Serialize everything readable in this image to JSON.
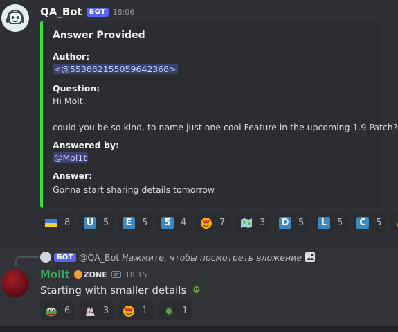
{
  "message1": {
    "username": "QA_Bot",
    "bot_tag": "БОТ",
    "timestamp": "18:06",
    "embed": {
      "accent_color": "#3ae03a",
      "title": "Answer Provided",
      "author_label": "Author:",
      "author_value": "<@553882155059642368>",
      "question_label": "Question:",
      "question_line1": "Hi Molt,",
      "question_line2": "could you be so kind, to name just one cool Feature in the upcoming 1.9 Patch?",
      "answered_by_label": "Answered by:",
      "answered_by_value": "@Mol1t",
      "answer_label": "Answer:",
      "answer_value": "Gonna start sharing details tomorrow"
    },
    "reactions": [
      {
        "icon": "ukraine-flag-icon",
        "count": "8"
      },
      {
        "icon": "regional-u-icon",
        "glyph": "U",
        "count": "5"
      },
      {
        "icon": "regional-e-icon",
        "glyph": "E",
        "count": "5"
      },
      {
        "icon": "digit-5-icon",
        "glyph": "5",
        "count": "4"
      },
      {
        "icon": "smiling-heart-icon",
        "count": "7"
      },
      {
        "icon": "map-icon",
        "count": "3"
      },
      {
        "icon": "regional-d-icon",
        "glyph": "D",
        "count": "5"
      },
      {
        "icon": "regional-l-icon",
        "glyph": "L",
        "count": "5"
      },
      {
        "icon": "regional-c-icon",
        "glyph": "C",
        "count": "5"
      }
    ]
  },
  "message2": {
    "reply": {
      "bot_tag": "БОТ",
      "name": "@QA_Bot",
      "text": "Нажмите, чтобы посмотреть вложение"
    },
    "username": "Mollt",
    "name_color": "#3ba55d",
    "zone_tag": "ZONE",
    "timestamp": "18:15",
    "text": "Starting with smaller details",
    "reactions": [
      {
        "icon": "pepe-icon",
        "count": "6"
      },
      {
        "icon": "creature-icon",
        "count": "3"
      },
      {
        "icon": "smiling-heart-icon",
        "count": "1"
      },
      {
        "icon": "hooded-figure-icon",
        "count": "1"
      }
    ]
  }
}
